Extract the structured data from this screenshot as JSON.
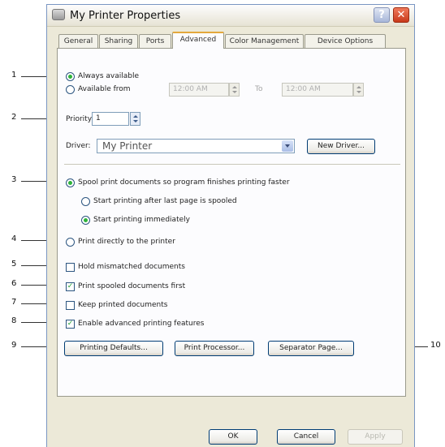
{
  "window": {
    "title": "My Printer Properties",
    "help_label": "?",
    "close_label": "✕"
  },
  "tabs": [
    {
      "label": "General"
    },
    {
      "label": "Sharing"
    },
    {
      "label": "Ports"
    },
    {
      "label": "Advanced"
    },
    {
      "label": "Color Management"
    },
    {
      "label": "Device Options"
    }
  ],
  "active_tab": "Advanced",
  "availability": {
    "always_label": "Always available",
    "from_label": "Available from",
    "from_time": "12:00 AM",
    "to_label": "To",
    "to_time": "12:00 AM"
  },
  "priority": {
    "label": "Priority:",
    "value": "1"
  },
  "driver": {
    "label": "Driver:",
    "value": "My Printer",
    "new_driver_label": "New Driver..."
  },
  "spool": {
    "spool_label": "Spool print documents so program finishes printing faster",
    "after_last_page_label": "Start printing after last page is spooled",
    "immediately_label": "Start printing immediately",
    "direct_label": "Print directly to the printer"
  },
  "options": {
    "hold_mismatched_label": "Hold mismatched documents",
    "print_spooled_first_label": "Print spooled documents first",
    "keep_printed_label": "Keep printed documents",
    "enable_advanced_label": "Enable advanced printing features",
    "check_mark": "✓"
  },
  "buttons": {
    "printing_defaults": "Printing Defaults...",
    "print_processor": "Print Processor...",
    "separator_page": "Separator Page...",
    "ok": "OK",
    "cancel": "Cancel",
    "apply": "Apply"
  },
  "callouts": [
    "1",
    "2",
    "3",
    "4",
    "5",
    "6",
    "7",
    "8",
    "9",
    "10"
  ]
}
